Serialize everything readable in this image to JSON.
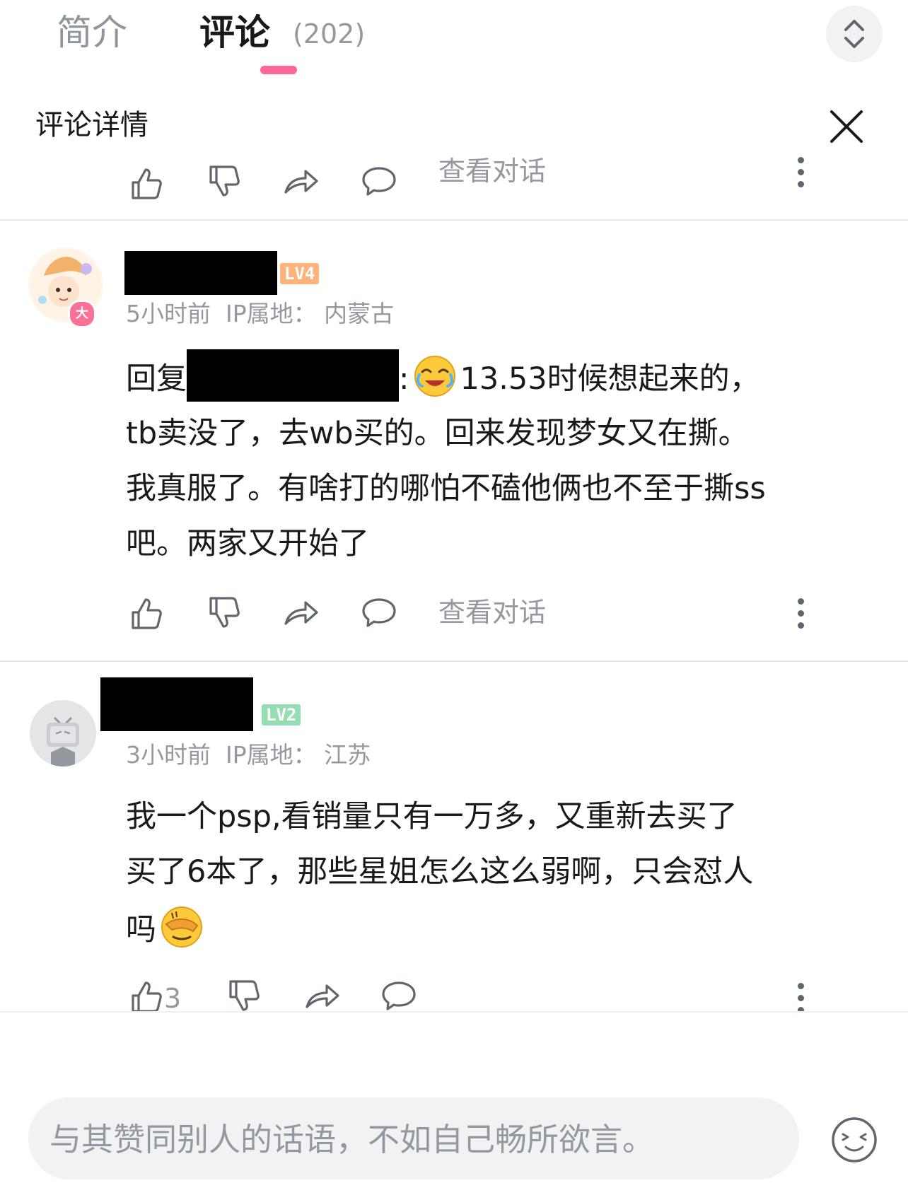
{
  "tabs": {
    "intro": "简介",
    "comments": "评论",
    "comment_count": "(202)"
  },
  "detail_title": "评论详情",
  "actions": {
    "view_conversation": "查看对话"
  },
  "comments": [
    {
      "level": "LV4",
      "time": "5小时前",
      "ip_label": "IP属地：",
      "ip_location": "内蒙古",
      "reply_prefix": "回复",
      "reply_colon": ":",
      "lines": [
        "13.53时候想起来的，",
        "tb卖没了，去wb买的。回来发现梦女又在撕。",
        "我真服了。有啥打的哪怕不磕他俩也不至于撕ss",
        "吧。两家又开始了"
      ],
      "like_count": ""
    },
    {
      "level": "LV2",
      "time": "3小时前",
      "ip_label": "IP属地：",
      "ip_location": "江苏",
      "lines": [
        "我一个psp,看销量只有一万多，又重新去买了",
        "买了6本了，那些星姐怎么这么弱啊，只会怼人",
        "吗"
      ],
      "like_count": "3"
    }
  ],
  "input": {
    "placeholder": "与其赞同别人的话语，不如自己畅所欲言。"
  },
  "colors": {
    "accent": "#ff6699",
    "lv4": "#ffb37c",
    "lv2": "#95ddb2",
    "muted_text": "#9499a0"
  }
}
